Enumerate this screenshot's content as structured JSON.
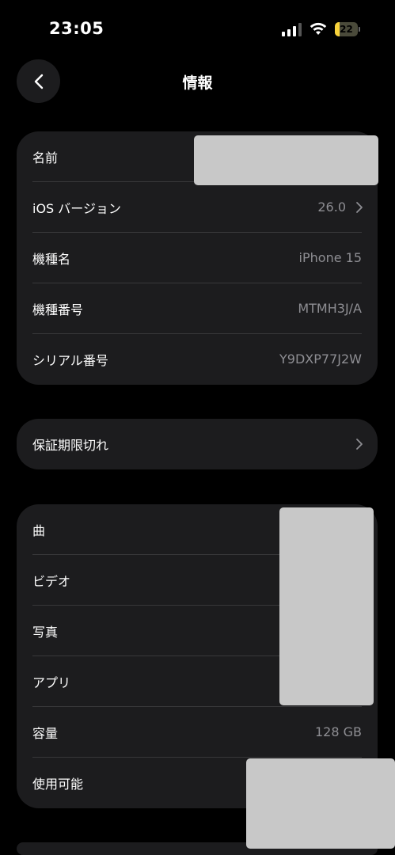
{
  "status_bar": {
    "time": "23:05",
    "battery_level": "22",
    "battery_fraction": 0.22,
    "icons": [
      "signal-icon",
      "wifi-icon",
      "battery-icon"
    ]
  },
  "nav": {
    "title": "情報",
    "back_icon": "chevron-left-icon"
  },
  "group1": {
    "rows": [
      {
        "label": "名前",
        "value": ""
      },
      {
        "label": "iOS バージョン",
        "value": "26.0"
      },
      {
        "label": "機種名",
        "value": "iPhone 15"
      },
      {
        "label": "機種番号",
        "value": "MTMH3J/A"
      },
      {
        "label": "シリアル番号",
        "value": "Y9DXP77J2W"
      }
    ]
  },
  "group2": {
    "rows": [
      {
        "label": "保証期限切れ"
      }
    ]
  },
  "group3": {
    "rows": [
      {
        "label": "曲",
        "value": ""
      },
      {
        "label": "ビデオ",
        "value": ""
      },
      {
        "label": "写真",
        "value": ""
      },
      {
        "label": "アプリ",
        "value": ""
      },
      {
        "label": "容量",
        "value": "128 GB"
      },
      {
        "label": "使用可能",
        "value": ""
      }
    ]
  },
  "colors": {
    "background": "#000000",
    "card": "#1c1c1e",
    "secondary_text": "#8e8e93",
    "battery": "#f7d23a",
    "redaction": "#c8c8c8"
  }
}
